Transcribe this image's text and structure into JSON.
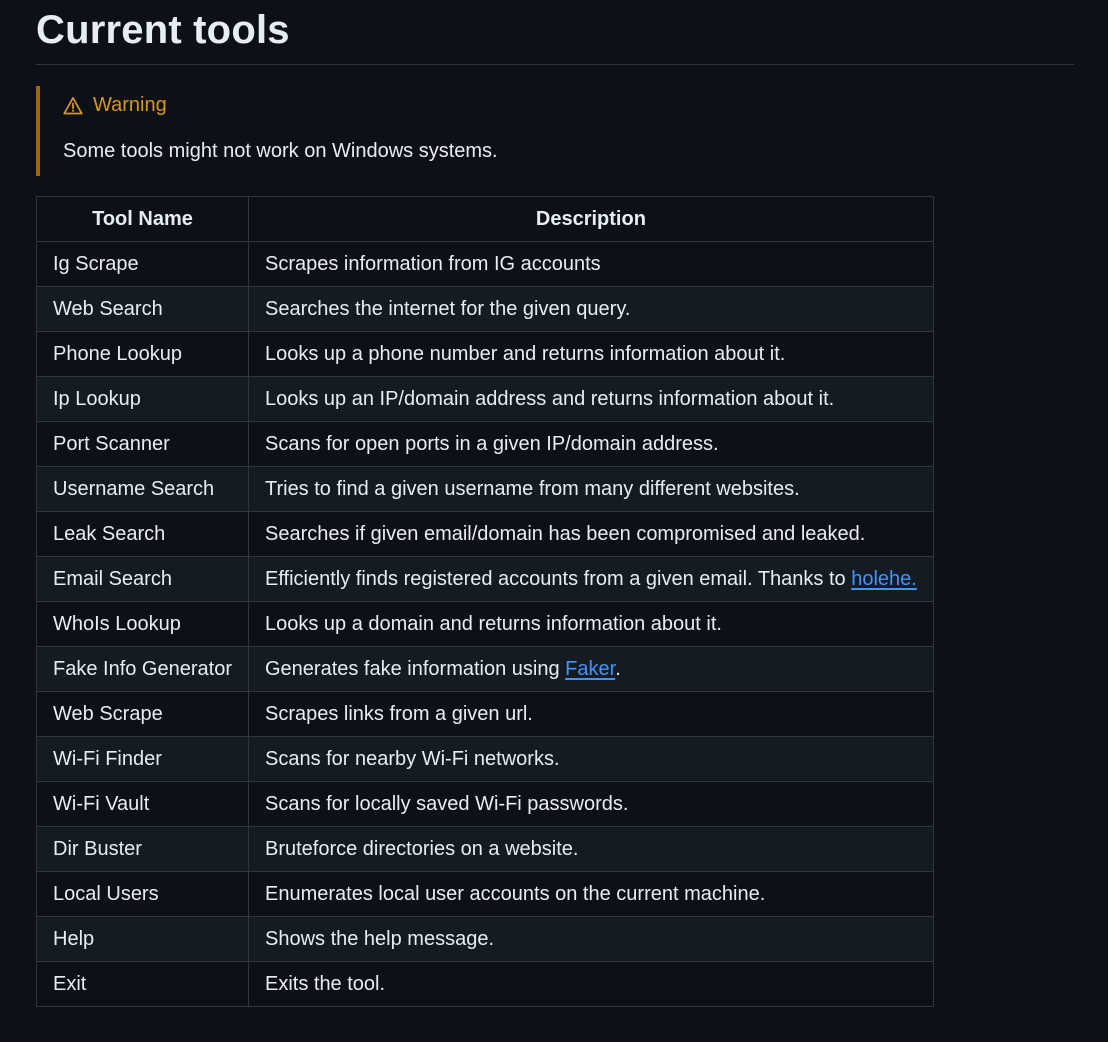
{
  "heading": "Current tools",
  "warning": {
    "title": "Warning",
    "body": "Some tools might not work on Windows systems.",
    "icon": "alert-triangle-icon",
    "color": "#d29922"
  },
  "table": {
    "headers": [
      "Tool Name",
      "Description"
    ],
    "rows": [
      {
        "name": "Ig Scrape",
        "desc": "Scrapes information from IG accounts"
      },
      {
        "name": "Web Search",
        "desc": "Searches the internet for the given query."
      },
      {
        "name": "Phone Lookup",
        "desc": "Looks up a phone number and returns information about it."
      },
      {
        "name": "Ip Lookup",
        "desc": "Looks up an IP/domain address and returns information about it."
      },
      {
        "name": "Port Scanner",
        "desc": "Scans for open ports in a given IP/domain address."
      },
      {
        "name": "Username Search",
        "desc": "Tries to find a given username from many different websites."
      },
      {
        "name": "Leak Search",
        "desc": "Searches if given email/domain has been compromised and leaked."
      },
      {
        "name": "Email Search",
        "desc": "Efficiently finds registered accounts from a given email. Thanks to ",
        "link": "holehe.",
        "after": ""
      },
      {
        "name": "WhoIs Lookup",
        "desc": "Looks up a domain and returns information about it."
      },
      {
        "name": "Fake Info Generator",
        "desc": "Generates fake information using ",
        "link": "Faker",
        "after": "."
      },
      {
        "name": "Web Scrape",
        "desc": "Scrapes links from a given url."
      },
      {
        "name": "Wi-Fi Finder",
        "desc": "Scans for nearby Wi-Fi networks."
      },
      {
        "name": "Wi-Fi Vault",
        "desc": "Scans for locally saved Wi-Fi passwords."
      },
      {
        "name": "Dir Buster",
        "desc": "Bruteforce directories on a website."
      },
      {
        "name": "Local Users",
        "desc": "Enumerates local user accounts on the current machine."
      },
      {
        "name": "Help",
        "desc": "Shows the help message."
      },
      {
        "name": "Exit",
        "desc": "Exits the tool."
      }
    ]
  },
  "colors": {
    "background": "#0d1117",
    "text": "#e6edf3",
    "link": "#4493f8",
    "border": "#30363d",
    "warning_accent": "#9e6a03"
  }
}
